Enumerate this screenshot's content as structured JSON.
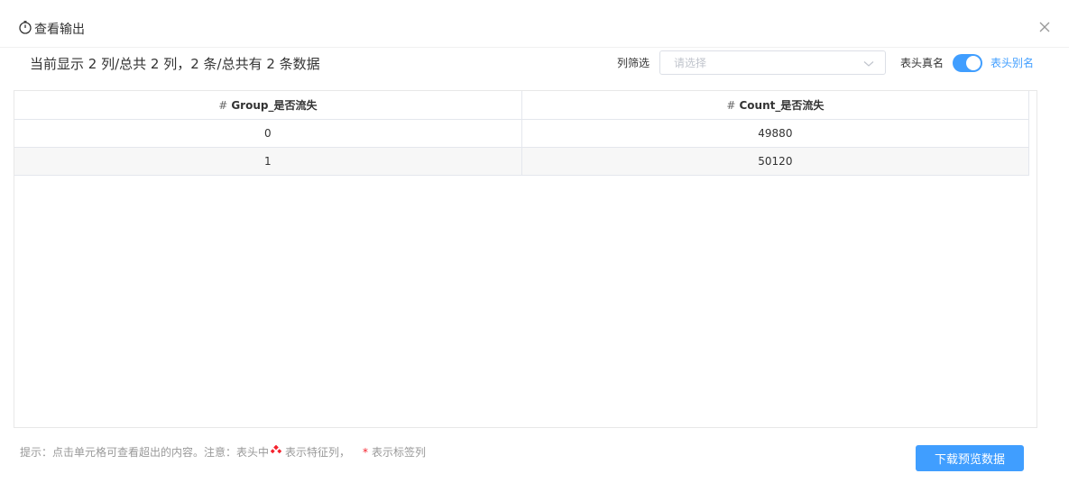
{
  "dialog": {
    "title": "查看输出",
    "close_icon": "close-icon"
  },
  "summary": {
    "text": "当前显示 2 列/总共 2 列，2 条/总共有 2 条数据"
  },
  "toolbar": {
    "column_filter_label": "列筛选",
    "column_filter_placeholder": "请选择",
    "header_real_name_label": "表头真名",
    "header_alias_label": "表头别名",
    "alias_toggle_on": true,
    "accent_color": "#409eff"
  },
  "table": {
    "columns": [
      {
        "prefix": "#",
        "name": "Group_是否流失"
      },
      {
        "prefix": "#",
        "name": "Count_是否流失"
      }
    ],
    "rows": [
      [
        "0",
        "49880"
      ],
      [
        "1",
        "50120"
      ]
    ]
  },
  "footer": {
    "hint_prefix": "提示：点击单元格可查看超出的内容。注意：表头中",
    "hint_feature": "表示特征列，",
    "hint_star": "*",
    "hint_label": "表示标签列",
    "download_label": "下载预览数据"
  }
}
